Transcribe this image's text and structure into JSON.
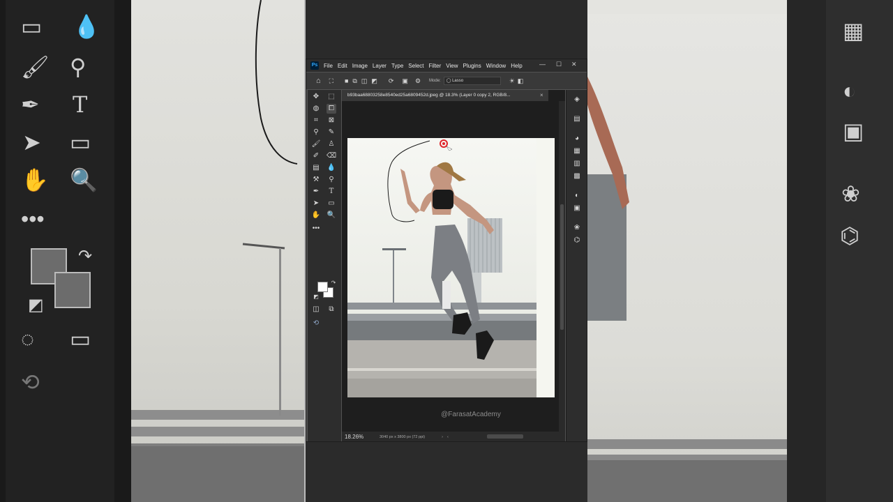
{
  "app": {
    "logo": "Ps"
  },
  "menubar": {
    "items": [
      "File",
      "Edit",
      "Image",
      "Layer",
      "Type",
      "Select",
      "Filter",
      "View",
      "Plugins",
      "Window",
      "Help"
    ]
  },
  "options_bar": {
    "mode_label": "Mode:",
    "mode_value": "Lasso"
  },
  "document": {
    "tab_title": "b93baa68803258e8540ed25a6809452d.jpeg @ 18.3% (Layer 0 copy 2, RGB/8...",
    "zoom": "18.26%",
    "dimensions": "3040 px x 3800 px (72 ppi)"
  },
  "watermark": "@FarasatAcademy",
  "colors": {
    "ui_dark": "#2d2d2d",
    "canvas_bg": "#1e1e1e",
    "foreground": "#ffffff",
    "background": "#ffffff",
    "lasso_stroke": "#1a1a1a",
    "cursor_red": "#e0252b"
  },
  "icons": {
    "tools": [
      "move-icon",
      "marquee-icon",
      "quick-selection-icon",
      "object-selection-icon",
      "crop-icon",
      "frame-icon",
      "eyedropper-icon",
      "spot-healing-icon",
      "brush-icon",
      "stamp-icon",
      "history-brush-icon",
      "eraser-icon",
      "gradient-icon",
      "blur-icon",
      "dodge-icon",
      "smudge-icon",
      "pen-icon",
      "type-icon",
      "path-selection-icon",
      "rectangle-icon",
      "hand-icon",
      "zoom-icon",
      "more-tools-icon",
      "quick-mask-icon",
      "screen-mode-icon"
    ],
    "panels": [
      "layers-icon",
      "libraries-icon",
      "color-icon",
      "swatches-icon",
      "gradients-icon",
      "patterns-icon",
      "adjustments-icon",
      "properties-icon",
      "channels-icon",
      "paths-icon"
    ]
  }
}
